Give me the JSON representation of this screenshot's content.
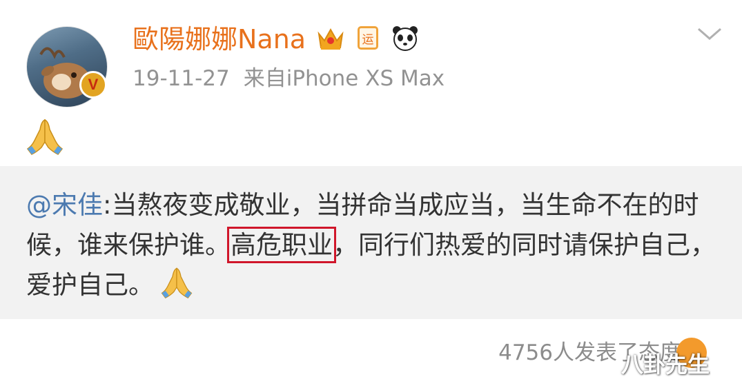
{
  "post": {
    "username": "歐陽娜娜Nana",
    "verified_mark": "V",
    "date": "19-11-27",
    "source": "来自iPhone XS Max",
    "badges": [
      "crown-icon",
      "yun-icon",
      "panda-icon"
    ],
    "yun_label": "运",
    "body_emoji": "🙏"
  },
  "quote": {
    "mention": "@宋佳",
    "colon": ":",
    "text_part1": "当熬夜变成敬业，当拼命当成应当，当生命不在的时候，谁来保护谁。",
    "highlight": "高危职业",
    "text_part2": "，同行们热爱的同时请保护自己，爱护自己。"
  },
  "footer": {
    "reactions": "4756人发表了态度"
  },
  "watermark": "八卦先生",
  "colors": {
    "username": "#e8711c",
    "mention": "#4c7ab0",
    "highlight_box": "#d0162a",
    "quote_bg": "#f2f2f2"
  }
}
